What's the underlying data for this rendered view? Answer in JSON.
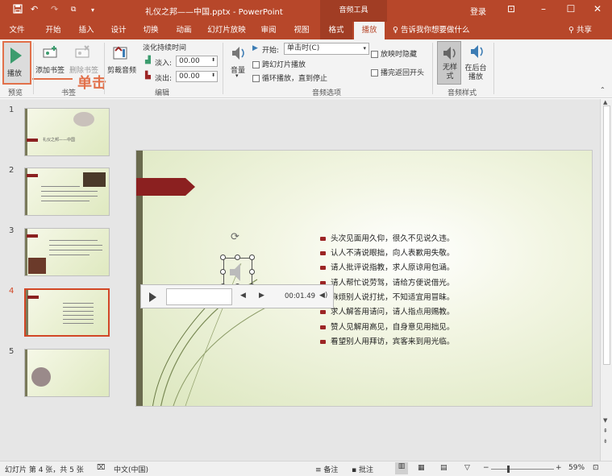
{
  "titlebar": {
    "save_icon": "save-icon",
    "undo_icon": "undo-icon",
    "redo_icon": "redo-icon",
    "start_icon": "start-from-beginning-icon",
    "customize_icon": "customize-quick-access-icon",
    "title": "礼仪之邦——中国.pptx  -  PowerPoint",
    "context_tools": "音频工具",
    "login": "登录",
    "ribbon_display_icon": "ribbon-display-options-icon",
    "minimize_icon": "minimize-icon",
    "maximize_icon": "maximize-icon",
    "close_icon": "close-icon"
  },
  "tabs": [
    "文件",
    "开始",
    "插入",
    "设计",
    "切换",
    "动画",
    "幻灯片放映",
    "审阅",
    "视图",
    "格式",
    "播放"
  ],
  "tell_me": "告诉我你想要做什么",
  "share": "共享",
  "ribbon": {
    "play_label": "播放",
    "add_bookmark": "添加书签",
    "remove_bookmark": "删除书签",
    "trim_audio": "剪裁音频",
    "fade_title": "淡化持续时间",
    "fade_in_label": "淡入:",
    "fade_in_value": "00.00",
    "fade_out_label": "淡出:",
    "fade_out_value": "00.00",
    "volume": "音量",
    "start_label": "开始:",
    "start_value": "单击时(C)",
    "play_across": "跨幻灯片播放",
    "loop_until_stopped": "循环播放，直到停止",
    "hide_during_show": "放映时隐藏",
    "rewind_after": "播完返回开头",
    "no_style": "无样式",
    "play_in_background": "在后台播放",
    "groups": {
      "preview": "预览",
      "bookmarks": "书签",
      "editing": "编辑",
      "audio_options": "音频选项",
      "audio_styles": "音频样式"
    },
    "callout": "单击"
  },
  "thumbnails": [
    {
      "num": "1",
      "text": "礼仪之邦——中国"
    },
    {
      "num": "2",
      "text": ""
    },
    {
      "num": "3",
      "text": ""
    },
    {
      "num": "4",
      "text": ""
    },
    {
      "num": "5",
      "text": ""
    }
  ],
  "selected_slide": 4,
  "slide": {
    "bullets": [
      "头次见面用久仰，很久不见说久违。",
      "认人不清说眼拙，向人表歉用失敬。",
      "请人批评说指教，求人原谅用包涵。",
      "请人帮忙说劳驾，请给方便说借光。",
      "麻烦别人说打扰，不知适宜用冒昧。",
      "求人解答用请问，请人指点用赐教。",
      "赞人见解用高见，自身意见用拙见。",
      "看望别人用拜访，宾客来到用光临。"
    ]
  },
  "player": {
    "time": "00:01.49"
  },
  "statusbar": {
    "slide_info": "幻灯片 第 4 张，共 5 张",
    "language": "中文(中国)",
    "notes": "备注",
    "comments": "批注",
    "zoom": "59%"
  },
  "colors": {
    "accent": "#B7472A",
    "callout": "#E2704A",
    "bullet_red": "#9C2525"
  }
}
